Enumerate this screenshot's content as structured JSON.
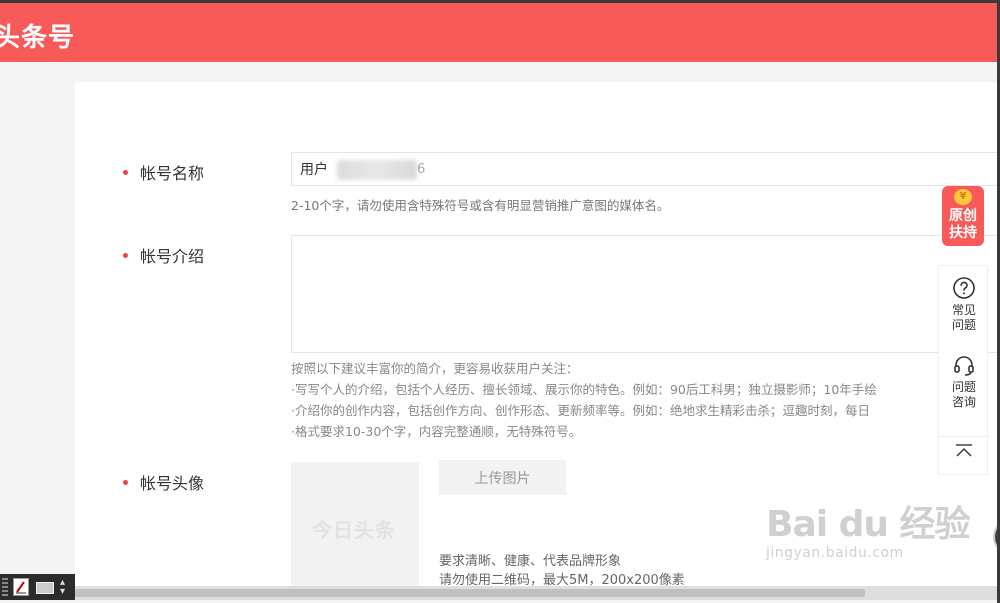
{
  "header": {
    "brand": "头条号",
    "color": "#f85959"
  },
  "form": {
    "account_name": {
      "label": "帐号名称",
      "value_prefix": "用户",
      "value_suffix": "6",
      "hint": "2-10个字，请勿使用含特殊符号或含有明显营销推广意图的媒体名。"
    },
    "account_intro": {
      "label": "帐号介绍",
      "value": "",
      "guide_title": "按照以下建议丰富你的简介，更容易收获用户关注：",
      "guide_lines": [
        "·写写个人的介绍，包括个人经历、擅长领域、展示你的特色。例如：90后工科男；独立摄影师；10年手绘",
        "·介绍你的创作内容，包括创作方向、创作形态、更新频率等。例如：绝地求生精彩击杀；逗趣时刻，每日",
        "·格式要求10-30个字，内容完整通顺，无特殊符号。"
      ]
    },
    "account_avatar": {
      "label": "帐号头像",
      "placeholder_text": "今日头条",
      "upload_label": "上传图片",
      "requirements": [
        "要求清晰、健康、代表品牌形象",
        "请勿使用二维码，最大5M，200x200像素"
      ]
    }
  },
  "side_widgets": {
    "original_badge": "原创扶持",
    "original_badge_icon": "¥",
    "faq": "常见问题",
    "consult": "问题咨询"
  },
  "watermark": {
    "main": "Bai du 经验",
    "sub": "jingyan.baidu.com"
  }
}
